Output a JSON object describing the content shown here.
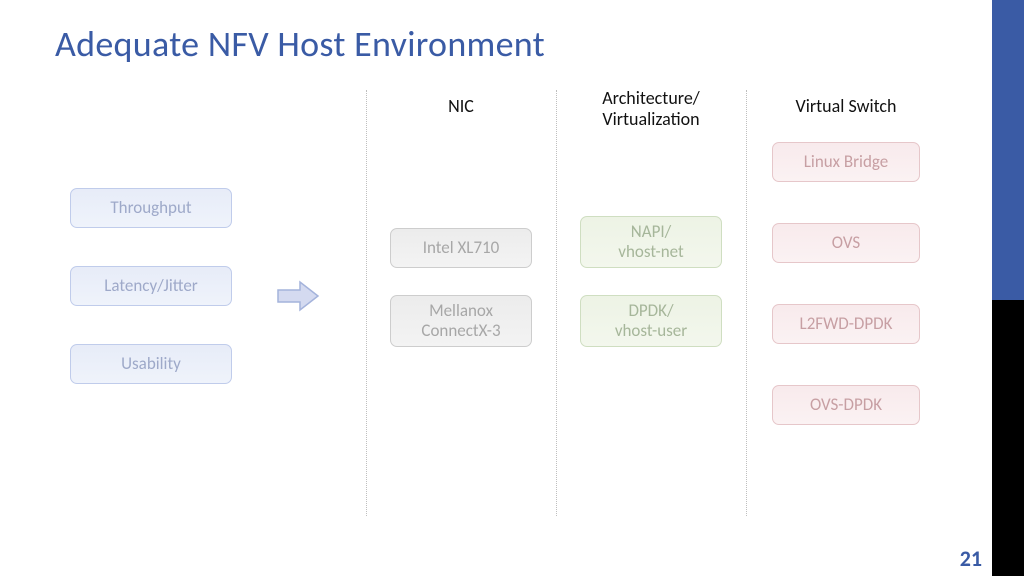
{
  "title": "Adequate NFV Host Environment",
  "page_number": "21",
  "columns": {
    "nic": {
      "header": "NIC"
    },
    "arch": {
      "header": "Architecture/\nVirtualization"
    },
    "vswitch": {
      "header": "Virtual Switch"
    }
  },
  "metrics": {
    "throughput": "Throughput",
    "latency": "Latency/Jitter",
    "usability": "Usability"
  },
  "nic_items": {
    "xl710": "Intel XL710",
    "connectx3": "Mellanox\nConnectX-3"
  },
  "arch_items": {
    "napi": "NAPI/\nvhost-net",
    "dpdk": "DPDK/\nvhost-user"
  },
  "vswitch_items": {
    "linux_bridge": "Linux Bridge",
    "ovs": "OVS",
    "l2fwd": "L2FWD-DPDK",
    "ovsdpdk": "OVS-DPDK"
  }
}
